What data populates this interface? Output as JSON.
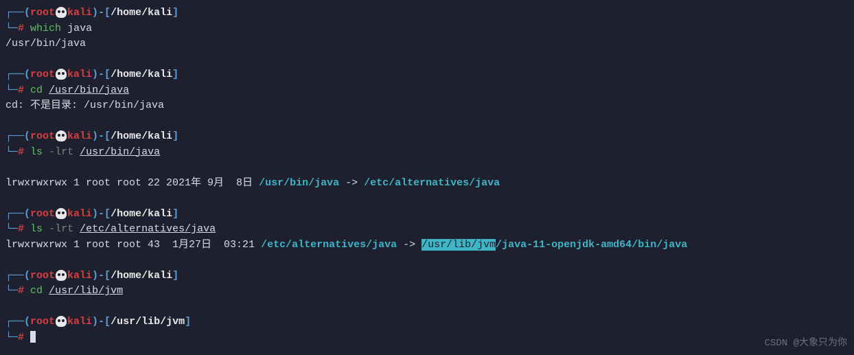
{
  "p1": {
    "user": "root",
    "host": "kali",
    "cwd": "/home/kali",
    "cmd": "which",
    "arg": "java"
  },
  "out1": "/usr/bin/java",
  "p2": {
    "user": "root",
    "host": "kali",
    "cwd": "/home/kali",
    "cmd": "cd",
    "arg": "/usr/bin/java"
  },
  "out2": "cd: 不是目录: /usr/bin/java",
  "p3": {
    "user": "root",
    "host": "kali",
    "cwd": "/home/kali",
    "cmd": "ls",
    "opt": "-lrt",
    "arg": "/usr/bin/java"
  },
  "ls1": {
    "perm": "lrwxrwxrwx 1 root root 22 2021年 9月  8日 ",
    "link": "/usr/bin/java",
    "arrow": " -> ",
    "target": "/etc/alternatives/java"
  },
  "p4": {
    "user": "root",
    "host": "kali",
    "cwd": "/home/kali",
    "cmd": "ls",
    "opt": "-lrt",
    "arg": "/etc/alternatives/java"
  },
  "ls2": {
    "perm": "lrwxrwxrwx 1 root root 43  1月27日  03:21 ",
    "link": "/etc/alternatives/java",
    "arrow": " -> ",
    "hl": "/usr/lib/jvm",
    "rest": "/java-11-openjdk-amd64/bin/java"
  },
  "p5": {
    "user": "root",
    "host": "kali",
    "cwd": "/home/kali",
    "cmd": "cd",
    "arg": "/usr/lib/jvm"
  },
  "p6": {
    "user": "root",
    "host": "kali",
    "cwd": "/usr/lib/jvm"
  },
  "glyph": {
    "top": "┌──(",
    "close": ")-[",
    "close2": "]",
    "bot": "└─",
    "hash": "#"
  },
  "watermark": "CSDN @大象只为你"
}
